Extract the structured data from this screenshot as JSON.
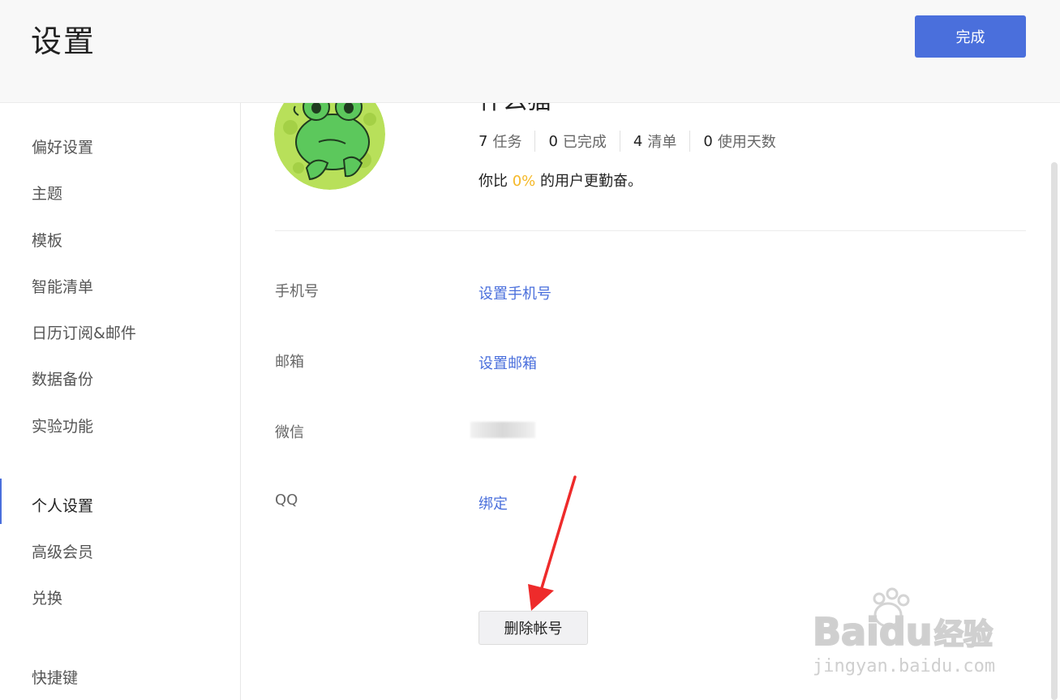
{
  "header": {
    "title": "设置",
    "done_label": "完成"
  },
  "sidebar": {
    "items": [
      {
        "label": "偏好设置"
      },
      {
        "label": "主题"
      },
      {
        "label": "模板"
      },
      {
        "label": "智能清单"
      },
      {
        "label": "日历订阅&邮件"
      },
      {
        "label": "数据备份"
      },
      {
        "label": "实验功能"
      },
      {
        "label": "个人设置",
        "active": true
      },
      {
        "label": "高级会员"
      },
      {
        "label": "兑换"
      },
      {
        "label": "快捷键"
      }
    ]
  },
  "profile": {
    "username": "什么猫",
    "stats": [
      {
        "num": "7",
        "label": "任务"
      },
      {
        "num": "0",
        "label": "已完成"
      },
      {
        "num": "4",
        "label": "清单"
      },
      {
        "num": "0",
        "label": "使用天数"
      }
    ],
    "diligence_prefix": "你比",
    "diligence_pct": "0%",
    "diligence_suffix": "的用户更勤奋。"
  },
  "account": {
    "phone_label": "手机号",
    "phone_link": "设置手机号",
    "email_label": "邮箱",
    "email_link": "设置邮箱",
    "wechat_label": "微信",
    "qq_label": "QQ",
    "qq_link": "绑定",
    "delete_label": "删除帐号"
  },
  "colors": {
    "accent": "#4a6fdc",
    "highlight": "#f5b827",
    "annotation_arrow": "#ee2b2b"
  },
  "watermark": {
    "brand": "Baidu",
    "suffix": "经验",
    "url": "jingyan.baidu.com"
  }
}
